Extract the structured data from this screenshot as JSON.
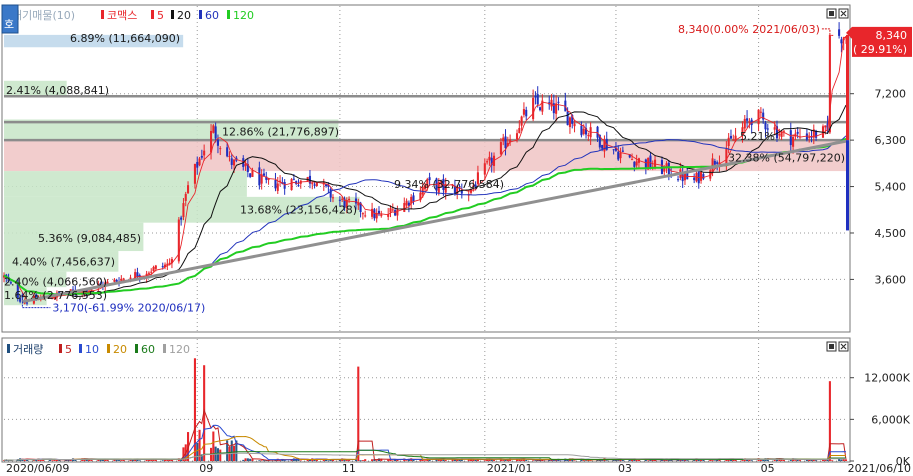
{
  "window": {
    "button_label": "호"
  },
  "colors": {
    "up": "#e8262b",
    "down": "#1f2fbf",
    "ma5": "#e8262b",
    "ma20": "#111111",
    "ma60": "#2233bb",
    "ma120": "#22cc22",
    "vol_ma5": "#c02020",
    "vol_ma10": "#2a4bd0",
    "vol_ma20": "#c88a00",
    "vol_ma60": "#1a7a1a",
    "vol_ma120": "#a0a0a0",
    "profile": "#c7e5c7",
    "profile_high": "#f0c4c4",
    "profile_top": "#bcd6ea",
    "trendline": "#909090",
    "grid": "#9a9a9a",
    "axis_bar_up": "#e8262b",
    "axis_bar_down": "#1f2fbf"
  },
  "legend": {
    "price": {
      "mode": "대기매물(10)",
      "name": "코맥스",
      "ma": [
        "5",
        "20",
        "60",
        "120"
      ]
    },
    "volume": {
      "name": "거래량",
      "ma": [
        "5",
        "10",
        "20",
        "60",
        "120"
      ]
    }
  },
  "price_axis": {
    "ticks": [
      "7,200",
      "6,300",
      "5,400",
      "4,500",
      "3,600"
    ]
  },
  "volume_axis": {
    "ticks": [
      "12,000K",
      "6,000K",
      "0K"
    ]
  },
  "x_axis": {
    "labels": [
      "2020/06/09",
      "09",
      "11",
      "2021/01",
      "03",
      "05",
      "2021/06/10"
    ]
  },
  "annotations": {
    "high_label": "8,340(0.00% 2021/06/03)",
    "low_label": "3,170(-61.99% 2020/06/17)",
    "current_price": "8,340",
    "current_change": "( 29.91%)"
  },
  "profile_labels": [
    "6.89% (11,664,090)",
    "2.41% (4,088,841)",
    "12.86% (21,776,897)",
    "32.38% (54,797,220)",
    "9.34% (32,776,584)",
    "13.68% (23,156,428)",
    "5.36% (9,084,485)",
    "4.40% (7,456,637)",
    "2.40% (4,066,560)",
    "1.64% (2,776,553)",
    "5.21%"
  ],
  "chart_data": [
    {
      "type": "candlestick",
      "title": "코맥스",
      "mode": "대기매물(10)",
      "moving_averages": [
        "5",
        "20",
        "60",
        "120"
      ],
      "x_range": [
        "2020/06/09",
        "2021/06/10"
      ],
      "x_ticks": [
        "2020/06/09",
        "09",
        "11",
        "2021/01",
        "03",
        "05",
        "2021/06/10"
      ],
      "y_ticks": [
        7200,
        6300,
        5400,
        4500,
        3600
      ],
      "ylim": [
        2600,
        8900
      ],
      "price_range_anchors": [
        {
          "date": "2020/06/09",
          "price": 3650
        },
        {
          "date": "2020/06/17",
          "price": 3170
        },
        {
          "date": "2020/07/15",
          "price": 3400
        },
        {
          "date": "2020/08/20",
          "price": 3900
        },
        {
          "date": "2020/08/28",
          "price": 5400
        },
        {
          "date": "2020/09/04",
          "price": 6150
        },
        {
          "date": "2020/09/08",
          "price": 6500
        },
        {
          "date": "2020/09/15",
          "price": 5900
        },
        {
          "date": "2020/10/01",
          "price": 5450
        },
        {
          "date": "2020/10/22",
          "price": 5550
        },
        {
          "date": "2020/10/31",
          "price": 5150
        },
        {
          "date": "2020/11/20",
          "price": 4800
        },
        {
          "date": "2020/12/01",
          "price": 5100
        },
        {
          "date": "2020/12/10",
          "price": 5450
        },
        {
          "date": "2020/12/28",
          "price": 5300
        },
        {
          "date": "2021/01/12",
          "price": 6200
        },
        {
          "date": "2021/01/25",
          "price": 7000
        },
        {
          "date": "2021/02/05",
          "price": 6900
        },
        {
          "date": "2021/02/15",
          "price": 6550
        },
        {
          "date": "2021/03/05",
          "price": 6000
        },
        {
          "date": "2021/03/25",
          "price": 5700
        },
        {
          "date": "2021/04/05",
          "price": 5500
        },
        {
          "date": "2021/04/20",
          "price": 6200
        },
        {
          "date": "2021/05/01",
          "price": 6800
        },
        {
          "date": "2021/05/15",
          "price": 6350
        },
        {
          "date": "2021/06/02",
          "price": 6450
        },
        {
          "date": "2021/06/03",
          "price": 8340
        },
        {
          "date": "2021/06/10",
          "price": 8340
        }
      ],
      "annotations": {
        "high": {
          "price": 8340,
          "change": "0.00%",
          "date": "2021/06/03"
        },
        "low": {
          "price": 3170,
          "change": "-61.99%",
          "date": "2020/06/17"
        },
        "current": {
          "price": 8340,
          "change": "29.91%"
        }
      },
      "volume_profile": [
        {
          "low": 7150,
          "high": 7450,
          "pct": 2.41,
          "volume": 4088841
        },
        {
          "low": 6300,
          "high": 6700,
          "pct": 12.86,
          "volume": 21776897
        },
        {
          "low": 5700,
          "high": 6300,
          "pct": 32.38,
          "volume": 54797220
        },
        {
          "low": 5200,
          "high": 5700,
          "pct": 9.34,
          "volume": 32776584
        },
        {
          "low": 4700,
          "high": 5200,
          "pct": 13.68,
          "volume": 23156428
        },
        {
          "low": 4150,
          "high": 4700,
          "pct": 5.36,
          "volume": 9084485
        },
        {
          "low": 3750,
          "high": 4150,
          "pct": 4.4,
          "volume": 7456637
        },
        {
          "low": 3450,
          "high": 3750,
          "pct": 2.4,
          "volume": 4066560
        },
        {
          "low": 3100,
          "high": 3450,
          "pct": 1.64,
          "volume": 2776553
        },
        {
          "low": 8100,
          "high": 8340,
          "pct": 6.89,
          "volume": 11664090
        }
      ],
      "horizontal_lines": [
        7150,
        6650,
        6300
      ],
      "trendline": [
        {
          "date": "2020/06/17",
          "price": 3170
        },
        {
          "date": "2021/06/10",
          "price": 6280
        }
      ]
    },
    {
      "type": "bar",
      "title": "거래량",
      "unit": "K",
      "moving_averages": [
        "5",
        "10",
        "20",
        "60",
        "120"
      ],
      "y_ticks": [
        12000,
        6000,
        0
      ],
      "ylim": [
        0,
        17000
      ],
      "spikes": [
        {
          "date": "2020/08/31",
          "volume": 14800
        },
        {
          "date": "2020/09/04",
          "volume": 13800
        },
        {
          "date": "2020/11/10",
          "volume": 13600
        },
        {
          "date": "2021/06/03",
          "volume": 11500
        }
      ]
    }
  ]
}
